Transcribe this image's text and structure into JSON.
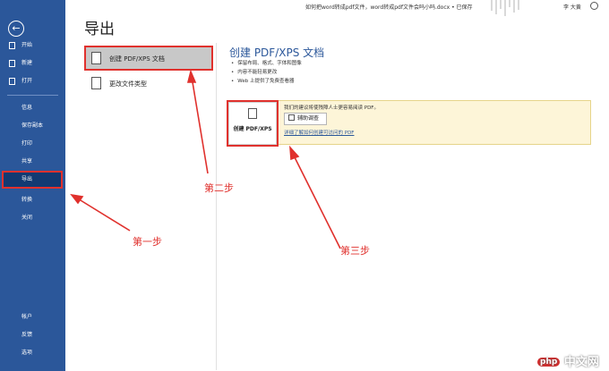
{
  "titlebar": {
    "document_title": "如何把word转成pdf文件，word转成pdf文件会吗小吗.docx • 已保存",
    "user_name": "李 大黄"
  },
  "sidebar": {
    "top_items": [
      {
        "label": "开始",
        "icon": "home-icon"
      },
      {
        "label": "新建",
        "icon": "new-document-icon"
      },
      {
        "label": "打开",
        "icon": "folder-icon"
      }
    ],
    "mid_items": [
      {
        "label": "信息"
      },
      {
        "label": "保存副本"
      },
      {
        "label": "打印"
      },
      {
        "label": "共享"
      },
      {
        "label": "导出"
      },
      {
        "label": "转换"
      },
      {
        "label": "关闭"
      }
    ],
    "bottom_items": [
      {
        "label": "帐户"
      },
      {
        "label": "反馈"
      },
      {
        "label": "选项"
      }
    ],
    "selected": "导出"
  },
  "main": {
    "heading": "导出",
    "options": [
      {
        "label": "创建 PDF/XPS 文档",
        "icon": "pdf-document-icon"
      },
      {
        "label": "更改文件类型",
        "icon": "change-file-type-icon"
      }
    ]
  },
  "content": {
    "title": "创建 PDF/XPS 文档",
    "bullets": [
      "保留布局、格式、字体和图像",
      "内容不能轻易更改",
      "Web 上提供了免费查看器"
    ],
    "create_button_label": "创建 PDF/XPS",
    "panel_text": "我们的建议将使残障人士更容易阅读 PDF。",
    "survey_button_label": "辅助调查",
    "learn_link": "详细了解如何创建可访问的 PDF"
  },
  "annotations": {
    "step1": "第一步",
    "step2": "第二步",
    "step3": "第三步",
    "color": "#e0312d"
  },
  "watermark": {
    "logo": "php",
    "text": "中文网"
  },
  "colors": {
    "sidebar": "#2b579a",
    "sidebar_selected": "#123a72",
    "panel_background": "#fdf5d8"
  }
}
